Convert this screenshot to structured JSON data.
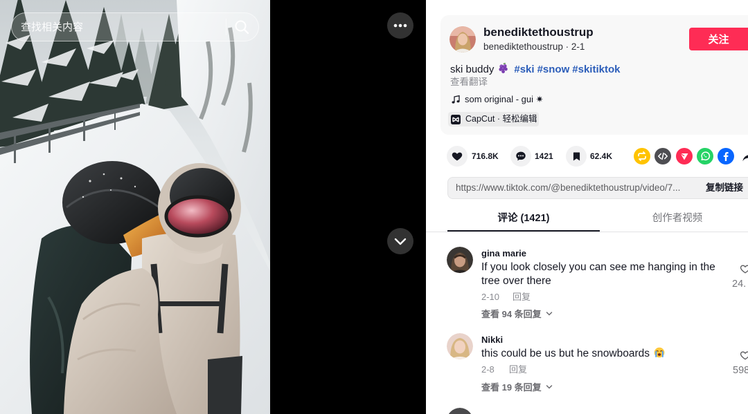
{
  "search": {
    "placeholder": "查找相关内容",
    "icon": "search-icon"
  },
  "player_controls": {
    "more_icon": "more-icon",
    "next_icon": "chevron-down-icon"
  },
  "author": {
    "username": "benediktethoustrup",
    "subline": "benediktethoustrup · 2-1",
    "follow_label": "关注"
  },
  "description": {
    "text": "ski buddy",
    "emoji_icon": "grapes-emoji-icon",
    "hashtags": [
      "#ski",
      "#snow",
      "#skitiktok"
    ],
    "translate_label": "查看翻译"
  },
  "music": {
    "icon": "music-note-icon",
    "title": "som original - gui ✷"
  },
  "capcut": {
    "icon": "capcut-icon",
    "label": "CapCut · 轻松编辑"
  },
  "stats": {
    "likes": "716.8K",
    "comments": "1421",
    "saves": "62.4K"
  },
  "share": [
    {
      "icon": "repost-icon",
      "color": "#FFC300"
    },
    {
      "icon": "embed-icon",
      "color": "#4E4E52"
    },
    {
      "icon": "send-icon",
      "color": "#FE2C55"
    },
    {
      "icon": "whatsapp-icon",
      "color": "#25D366"
    },
    {
      "icon": "facebook-icon",
      "color": "#0866FF"
    },
    {
      "icon": "share-arrow-icon",
      "color": "#161823"
    }
  ],
  "link": {
    "url": "https://www.tiktok.com/@benediktethoustrup/video/7...",
    "copy_label": "复制链接"
  },
  "tabs": [
    {
      "label": "评论 (1421)",
      "active": true
    },
    {
      "label": "创作者视频",
      "active": false
    }
  ],
  "comments": [
    {
      "name": "gina marie",
      "text": "If you look closely you can see me hanging in the tree over there",
      "date": "2-10",
      "reply_label": "回复",
      "view_replies": "查看 94 条回复",
      "likes": "24."
    },
    {
      "name": "Nikki",
      "text": "this could be us but he snowboards",
      "emoji_icon": "loudly-crying-face-emoji-icon",
      "date": "2-8",
      "reply_label": "回复",
      "view_replies": "查看 19 条回复",
      "likes": "598"
    }
  ],
  "colors": {
    "accent": "#FE2C55",
    "hashtag": "#2B5DB9",
    "text": "#161823",
    "muted": "#8A8B91",
    "card_bg": "#F8F8F8"
  }
}
